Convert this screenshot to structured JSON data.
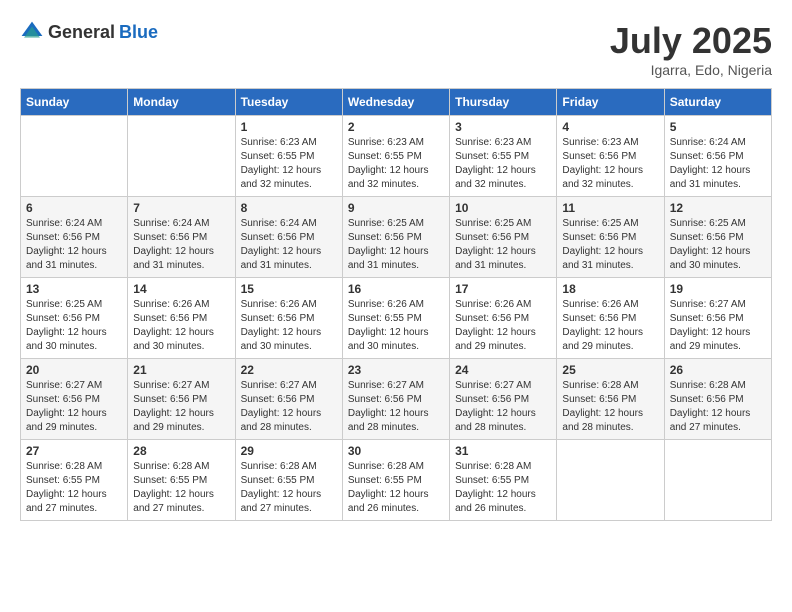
{
  "header": {
    "logo_general": "General",
    "logo_blue": "Blue",
    "month_title": "July 2025",
    "location": "Igarra, Edo, Nigeria"
  },
  "days_of_week": [
    "Sunday",
    "Monday",
    "Tuesday",
    "Wednesday",
    "Thursday",
    "Friday",
    "Saturday"
  ],
  "weeks": [
    [
      {
        "day": "",
        "sunrise": "",
        "sunset": "",
        "daylight": ""
      },
      {
        "day": "",
        "sunrise": "",
        "sunset": "",
        "daylight": ""
      },
      {
        "day": "1",
        "sunrise": "Sunrise: 6:23 AM",
        "sunset": "Sunset: 6:55 PM",
        "daylight": "Daylight: 12 hours and 32 minutes."
      },
      {
        "day": "2",
        "sunrise": "Sunrise: 6:23 AM",
        "sunset": "Sunset: 6:55 PM",
        "daylight": "Daylight: 12 hours and 32 minutes."
      },
      {
        "day": "3",
        "sunrise": "Sunrise: 6:23 AM",
        "sunset": "Sunset: 6:55 PM",
        "daylight": "Daylight: 12 hours and 32 minutes."
      },
      {
        "day": "4",
        "sunrise": "Sunrise: 6:23 AM",
        "sunset": "Sunset: 6:56 PM",
        "daylight": "Daylight: 12 hours and 32 minutes."
      },
      {
        "day": "5",
        "sunrise": "Sunrise: 6:24 AM",
        "sunset": "Sunset: 6:56 PM",
        "daylight": "Daylight: 12 hours and 31 minutes."
      }
    ],
    [
      {
        "day": "6",
        "sunrise": "Sunrise: 6:24 AM",
        "sunset": "Sunset: 6:56 PM",
        "daylight": "Daylight: 12 hours and 31 minutes."
      },
      {
        "day": "7",
        "sunrise": "Sunrise: 6:24 AM",
        "sunset": "Sunset: 6:56 PM",
        "daylight": "Daylight: 12 hours and 31 minutes."
      },
      {
        "day": "8",
        "sunrise": "Sunrise: 6:24 AM",
        "sunset": "Sunset: 6:56 PM",
        "daylight": "Daylight: 12 hours and 31 minutes."
      },
      {
        "day": "9",
        "sunrise": "Sunrise: 6:25 AM",
        "sunset": "Sunset: 6:56 PM",
        "daylight": "Daylight: 12 hours and 31 minutes."
      },
      {
        "day": "10",
        "sunrise": "Sunrise: 6:25 AM",
        "sunset": "Sunset: 6:56 PM",
        "daylight": "Daylight: 12 hours and 31 minutes."
      },
      {
        "day": "11",
        "sunrise": "Sunrise: 6:25 AM",
        "sunset": "Sunset: 6:56 PM",
        "daylight": "Daylight: 12 hours and 31 minutes."
      },
      {
        "day": "12",
        "sunrise": "Sunrise: 6:25 AM",
        "sunset": "Sunset: 6:56 PM",
        "daylight": "Daylight: 12 hours and 30 minutes."
      }
    ],
    [
      {
        "day": "13",
        "sunrise": "Sunrise: 6:25 AM",
        "sunset": "Sunset: 6:56 PM",
        "daylight": "Daylight: 12 hours and 30 minutes."
      },
      {
        "day": "14",
        "sunrise": "Sunrise: 6:26 AM",
        "sunset": "Sunset: 6:56 PM",
        "daylight": "Daylight: 12 hours and 30 minutes."
      },
      {
        "day": "15",
        "sunrise": "Sunrise: 6:26 AM",
        "sunset": "Sunset: 6:56 PM",
        "daylight": "Daylight: 12 hours and 30 minutes."
      },
      {
        "day": "16",
        "sunrise": "Sunrise: 6:26 AM",
        "sunset": "Sunset: 6:55 PM",
        "daylight": "Daylight: 12 hours and 30 minutes."
      },
      {
        "day": "17",
        "sunrise": "Sunrise: 6:26 AM",
        "sunset": "Sunset: 6:56 PM",
        "daylight": "Daylight: 12 hours and 29 minutes."
      },
      {
        "day": "18",
        "sunrise": "Sunrise: 6:26 AM",
        "sunset": "Sunset: 6:56 PM",
        "daylight": "Daylight: 12 hours and 29 minutes."
      },
      {
        "day": "19",
        "sunrise": "Sunrise: 6:27 AM",
        "sunset": "Sunset: 6:56 PM",
        "daylight": "Daylight: 12 hours and 29 minutes."
      }
    ],
    [
      {
        "day": "20",
        "sunrise": "Sunrise: 6:27 AM",
        "sunset": "Sunset: 6:56 PM",
        "daylight": "Daylight: 12 hours and 29 minutes."
      },
      {
        "day": "21",
        "sunrise": "Sunrise: 6:27 AM",
        "sunset": "Sunset: 6:56 PM",
        "daylight": "Daylight: 12 hours and 29 minutes."
      },
      {
        "day": "22",
        "sunrise": "Sunrise: 6:27 AM",
        "sunset": "Sunset: 6:56 PM",
        "daylight": "Daylight: 12 hours and 28 minutes."
      },
      {
        "day": "23",
        "sunrise": "Sunrise: 6:27 AM",
        "sunset": "Sunset: 6:56 PM",
        "daylight": "Daylight: 12 hours and 28 minutes."
      },
      {
        "day": "24",
        "sunrise": "Sunrise: 6:27 AM",
        "sunset": "Sunset: 6:56 PM",
        "daylight": "Daylight: 12 hours and 28 minutes."
      },
      {
        "day": "25",
        "sunrise": "Sunrise: 6:28 AM",
        "sunset": "Sunset: 6:56 PM",
        "daylight": "Daylight: 12 hours and 28 minutes."
      },
      {
        "day": "26",
        "sunrise": "Sunrise: 6:28 AM",
        "sunset": "Sunset: 6:56 PM",
        "daylight": "Daylight: 12 hours and 27 minutes."
      }
    ],
    [
      {
        "day": "27",
        "sunrise": "Sunrise: 6:28 AM",
        "sunset": "Sunset: 6:55 PM",
        "daylight": "Daylight: 12 hours and 27 minutes."
      },
      {
        "day": "28",
        "sunrise": "Sunrise: 6:28 AM",
        "sunset": "Sunset: 6:55 PM",
        "daylight": "Daylight: 12 hours and 27 minutes."
      },
      {
        "day": "29",
        "sunrise": "Sunrise: 6:28 AM",
        "sunset": "Sunset: 6:55 PM",
        "daylight": "Daylight: 12 hours and 27 minutes."
      },
      {
        "day": "30",
        "sunrise": "Sunrise: 6:28 AM",
        "sunset": "Sunset: 6:55 PM",
        "daylight": "Daylight: 12 hours and 26 minutes."
      },
      {
        "day": "31",
        "sunrise": "Sunrise: 6:28 AM",
        "sunset": "Sunset: 6:55 PM",
        "daylight": "Daylight: 12 hours and 26 minutes."
      },
      {
        "day": "",
        "sunrise": "",
        "sunset": "",
        "daylight": ""
      },
      {
        "day": "",
        "sunrise": "",
        "sunset": "",
        "daylight": ""
      }
    ]
  ]
}
